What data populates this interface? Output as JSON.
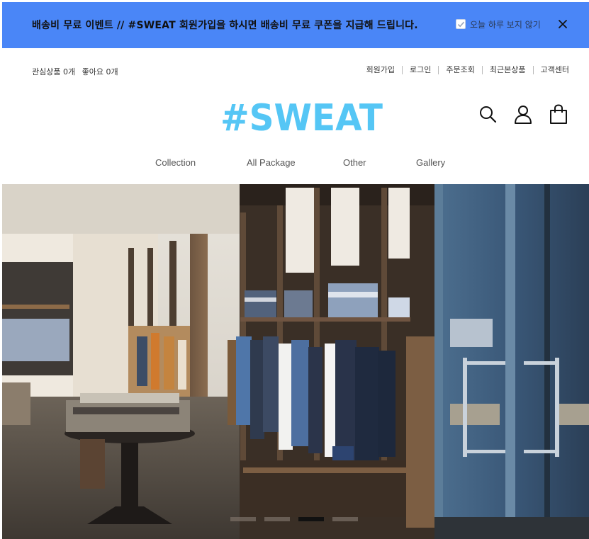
{
  "promo": {
    "text": "배송비 무료 이벤트 // #SWEAT 회원가입을 하시면 배송비 무료 쿠폰을 지급해 드립니다.",
    "hide_today_label": "오늘 하루 보지 않기",
    "hide_today_checked": true,
    "bg_color": "#4a86f7"
  },
  "util_left": {
    "wishlist": "관심상품 0개",
    "likes": "좋아요 0개"
  },
  "util_right": [
    "회원가입",
    "로그인",
    "주문조회",
    "최근본상품",
    "고객센터"
  ],
  "logo": {
    "text": "#SWEAT",
    "color": "#55c6f5"
  },
  "header_icons": [
    "search-icon",
    "user-icon",
    "shopping-bag-icon"
  ],
  "nav": [
    "Collection",
    "All Package",
    "Other",
    "Gallery"
  ],
  "slider": {
    "slide_count": 4,
    "active_index": 2
  }
}
